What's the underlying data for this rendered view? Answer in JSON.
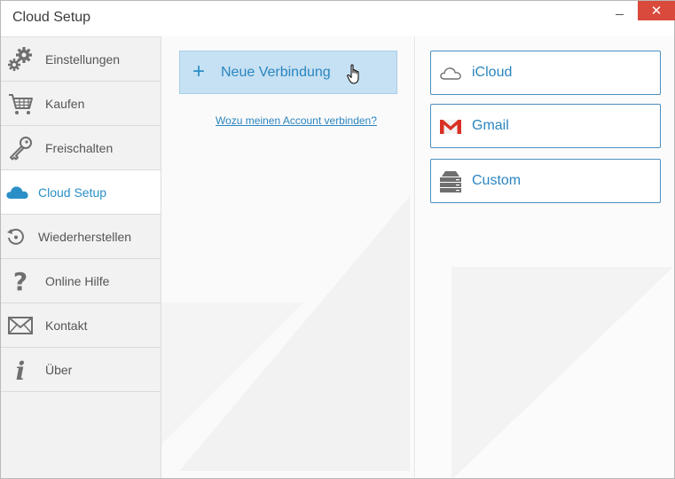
{
  "window": {
    "title": "Cloud Setup",
    "close_symbol": "✕"
  },
  "sidebar": {
    "items": [
      {
        "label": "Einstellungen",
        "icon": "gears-icon"
      },
      {
        "label": "Kaufen",
        "icon": "cart-icon"
      },
      {
        "label": "Freischalten",
        "icon": "key-icon"
      },
      {
        "label": "Cloud Setup",
        "icon": "cloud-icon",
        "active": true
      },
      {
        "label": "Wiederherstellen",
        "icon": "restore-icon"
      },
      {
        "label": "Online Hilfe",
        "icon": "question-icon"
      },
      {
        "label": "Kontakt",
        "icon": "envelope-icon"
      },
      {
        "label": "Über",
        "icon": "info-icon"
      }
    ]
  },
  "main": {
    "new_connection_label": "Neue Verbindung",
    "plus_symbol": "+",
    "why_link": "Wozu meinen Account verbinden?"
  },
  "providers": {
    "items": [
      {
        "label": "iCloud",
        "icon": "cloud-outline-icon"
      },
      {
        "label": "Gmail",
        "icon": "gmail-icon"
      },
      {
        "label": "Custom",
        "icon": "server-icon"
      }
    ]
  },
  "colors": {
    "accent": "#2a8fc7",
    "button_bg": "#c6e1f3",
    "close_red": "#d94a3c",
    "gmail_red": "#d93025"
  }
}
